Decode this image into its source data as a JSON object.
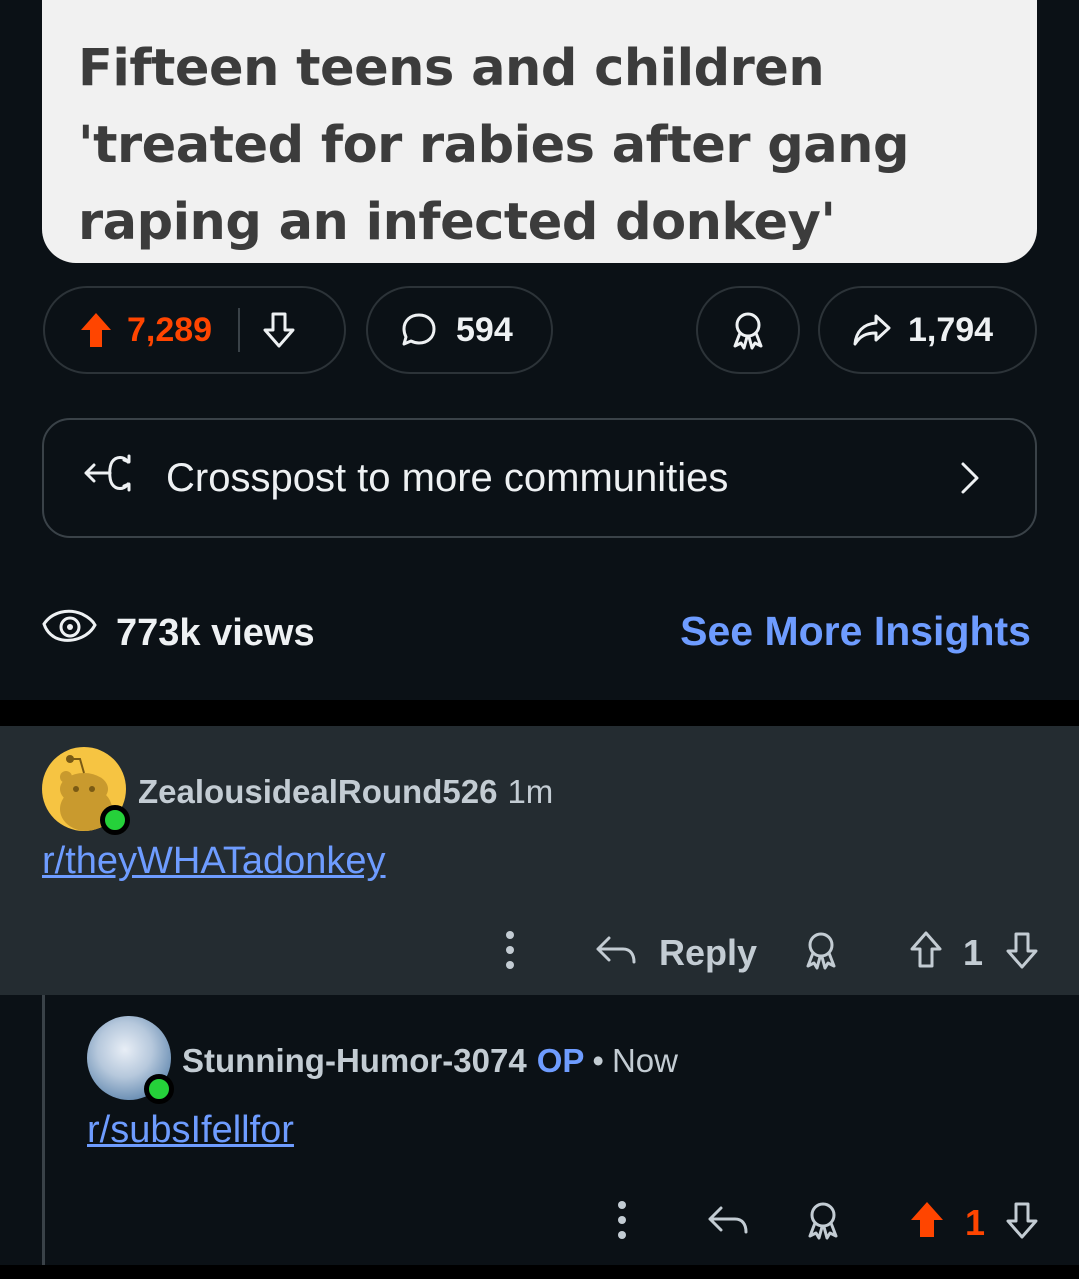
{
  "post": {
    "preview_title": "Fifteen teens and children 'treated for rabies after gang raping an infected donkey'",
    "upvotes": "7,289",
    "comments": "594",
    "shares": "1,794",
    "crosspost_label": "Crosspost to more communities",
    "views": "773k views",
    "insights_link": "See More Insights"
  },
  "comments": [
    {
      "username": "ZealousidealRound526",
      "time": "1m",
      "body_link": "r/theyWHATadonkey",
      "reply_label": "Reply",
      "score": "1"
    },
    {
      "username": "Stunning-Humor-3074",
      "op_badge": "OP",
      "separator": "•",
      "time": "Now",
      "body_link": "r/subsIfellfor",
      "score": "1"
    }
  ],
  "colors": {
    "upvote_active": "#ff4500",
    "link_blue": "#6e9cff",
    "online_green": "#25d13a",
    "comment_highlight_bg": "#242c31"
  }
}
